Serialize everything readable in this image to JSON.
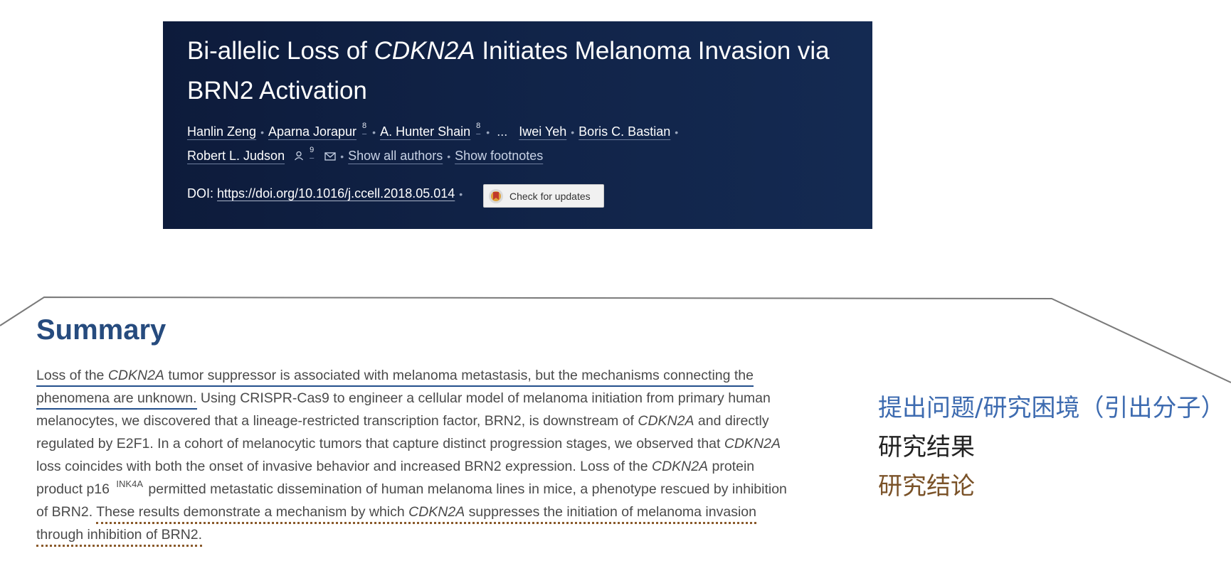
{
  "header": {
    "title_part1": "Bi-allelic Loss of ",
    "title_italic": "CDKN2A",
    "title_part2": " Initiates Melanoma Invasion via BRN2 Activation",
    "authors_line1": [
      {
        "name": "Hanlin Zeng"
      },
      {
        "name": "Aparna Jorapur",
        "sup": "8"
      },
      {
        "name": "A. Hunter Shain",
        "sup": "8"
      },
      {
        "name": "..."
      },
      {
        "name": "Iwei Yeh"
      },
      {
        "name": "Boris C. Bastian"
      }
    ],
    "author_last": "Robert L. Judson",
    "author_last_sup": "9",
    "show_all_authors": "Show all authors",
    "show_footnotes": "Show footnotes",
    "doi_label": "DOI:",
    "doi_url": "https://doi.org/10.1016/j.ccell.2018.05.014",
    "check_updates": "Check for updates",
    "icons": {
      "person": "person-icon",
      "mail": "mail-icon",
      "crossmark": "crossmark-icon"
    },
    "colors": {
      "background": "#0d1b3b",
      "text": "#ffffff"
    }
  },
  "summary": {
    "heading": "Summary",
    "l1_a": "Loss of the ",
    "l1_i": "CDKN2A",
    "l1_b": " tumor suppressor is associated with melanoma metastasis, but the mechanisms connecting the",
    "l2_a": "phenomena are unknown.",
    "l2_b": " Using CRISPR-Cas9 to engineer a cellular model of melanoma initiation from primary human",
    "l3_a": "melanocytes, we discovered that a lineage-restricted transcription factor, BRN2, is downstream of ",
    "l3_i": "CDKN2A",
    "l3_b": " and directly",
    "l4_a": "regulated by E2F1. In a cohort of melanocytic tumors that capture distinct progression stages, we observed that ",
    "l4_i": "CDKN2A",
    "l5_a": "loss coincides with both the onset of invasive behavior and increased BRN2 expression. Loss of the ",
    "l5_i": "CDKN2A",
    "l5_b": " protein",
    "l6_a": "product p16 ",
    "l6_sup": "INK4A",
    "l6_b": " permitted metastatic dissemination of human melanoma lines in mice, a phenotype rescued by inhibition",
    "l7_a": "of BRN2. ",
    "l7_u1": "These results demonstrate a mechanism by which ",
    "l7_i": "CDKN2A",
    "l7_u2": " suppresses the initiation of melanoma invasion",
    "l8_a": "through inhibition of BRN2.",
    "colors": {
      "heading": "#264b7e",
      "text": "#4a4a4a",
      "underline_problem": "#234f8c",
      "underline_conclusion": "#8a5a2b"
    }
  },
  "annotations": {
    "problem": "提出问题/研究困境（引出分子）",
    "results": "研究结果",
    "conclusion": "研究结论",
    "colors": {
      "problem": "#3d6bb0",
      "results": "#222222",
      "conclusion": "#7a5228"
    }
  }
}
